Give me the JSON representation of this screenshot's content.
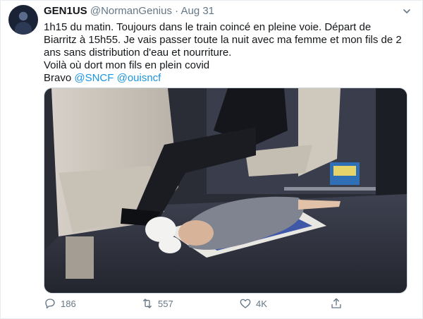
{
  "tweet": {
    "author_name": "GEN1US",
    "handle": "@NormanGenius",
    "separator": "·",
    "date": "Aug 31",
    "text_lines": [
      "1h15 du matin. Toujours dans le train coincé en pleine voie. Départ de",
      "Biarritz à 15h55. Je vais passer toute la nuit avec ma femme et mon fils de 2",
      "ans sans distribution d'eau et nourriture.",
      "Voilà où dort mon fils en plein covid"
    ],
    "last_line_prefix": "Bravo ",
    "mentions": [
      "@SNCF",
      "@ouisncf"
    ],
    "mention_separator": " "
  },
  "actions": {
    "reply": {
      "icon": "reply-icon",
      "count": "186"
    },
    "retweet": {
      "icon": "retweet-icon",
      "count": "557"
    },
    "like": {
      "icon": "heart-icon",
      "count": "4K"
    },
    "share": {
      "icon": "share-icon"
    }
  },
  "colors": {
    "link": "#1b95e0",
    "secondary_text": "#657786",
    "border": "#e6ecf0"
  }
}
